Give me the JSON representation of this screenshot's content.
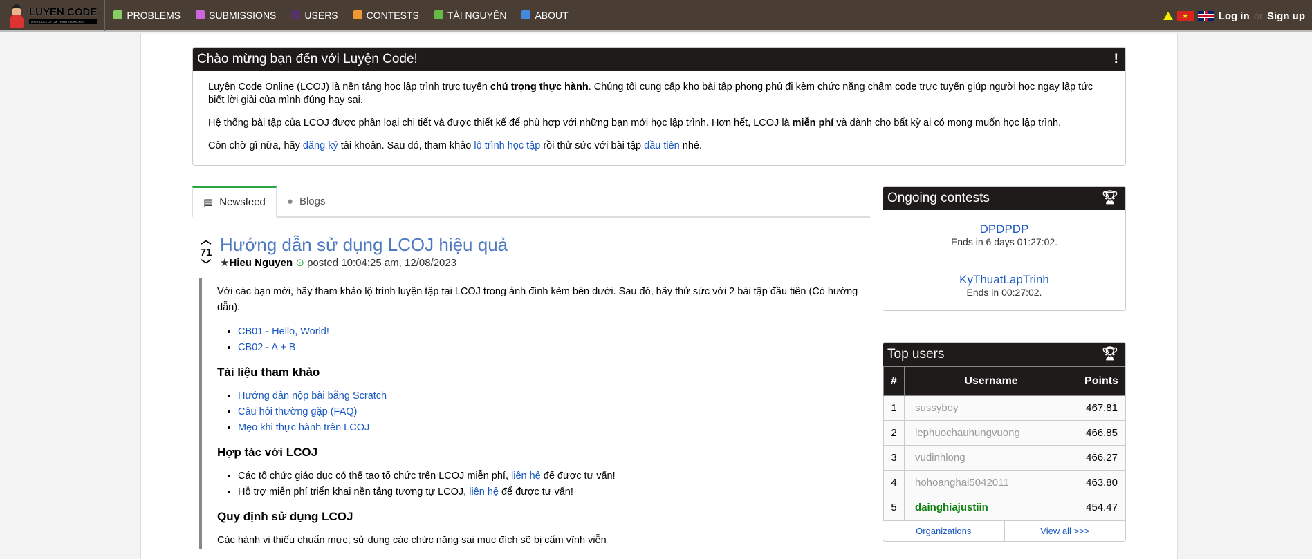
{
  "nav": {
    "logo_title": "LUYEN CODE",
    "logo_subtitle": "A PRODUCT OF LAP TRINH KHONG KHO",
    "items": [
      {
        "label": "PROBLEMS",
        "icon": "puzzle-icon",
        "color": "#8c6"
      },
      {
        "label": "SUBMISSIONS",
        "icon": "inbox-icon",
        "color": "#c6d"
      },
      {
        "label": "USERS",
        "icon": "users-icon",
        "color": "#536"
      },
      {
        "label": "CONTESTS",
        "icon": "trophy-icon",
        "color": "#e93"
      },
      {
        "label": "TÀI NGUYÊN",
        "icon": "books-icon",
        "color": "#6b4"
      },
      {
        "label": "ABOUT",
        "icon": "info-icon",
        "color": "#48d"
      }
    ],
    "login": "Log in",
    "or": "or",
    "signup": "Sign up"
  },
  "welcome": {
    "title": "Chào mừng bạn đến với Luyện Code!",
    "icon": "!",
    "p1a": "Luyện Code Online (LCOJ) là nền tảng học lập trình trực tuyến ",
    "p1b": "chú trọng thực hành",
    "p1c": ". Chúng tôi cung cấp kho bài tập phong phú đi kèm chức năng chấm code trực tuyến giúp người học ngay lập tức biết lời giải của mình đúng hay sai.",
    "p2a": "Hệ thống bài tập của LCOJ được phân loại chi tiết và được thiết kế để phù hợp với những bạn mới học lập trình. Hơn hết, LCOJ là ",
    "p2b": "miễn phí",
    "p2c": " và dành cho bất kỳ ai có mong muốn học lập trình.",
    "p3a": "Còn chờ gì nữa, hãy ",
    "p3b": "đăng ký",
    "p3c": " tài khoản. Sau đó, tham khảo ",
    "p3d": "lộ trình học tập",
    "p3e": " rồi thử sức với bài tập ",
    "p3f": "đầu tiên",
    "p3g": " nhé."
  },
  "tabs": [
    {
      "label": "Newsfeed",
      "active": true
    },
    {
      "label": "Blogs",
      "active": false
    }
  ],
  "post": {
    "votes": "71",
    "title": "Hướng dẫn sử dụng LCOJ hiệu quả",
    "author": "Hieu Nguyen",
    "posted": "posted 10:04:25 am, 12/08/2023",
    "intro": "Với các bạn mới, hãy tham khảo lộ trình luyện tập tại LCOJ trong ảnh đính kèm bên dưới. Sau đó, hãy thử sức với 2 bài tập đầu tiên (Có hướng dẫn).",
    "links1": [
      "CB01 - Hello, World!",
      "CB02 - A + B"
    ],
    "h1": "Tài liệu tham khảo",
    "links2": [
      "Hướng dẫn nộp bài bằng Scratch",
      "Câu hỏi thường gặp (FAQ)",
      "Mẹo khi thực hành trên LCOJ"
    ],
    "h2": "Hợp tác với LCOJ",
    "b1a": "Các tổ chức giáo dục có thể tạo tổ chức trên LCOJ miễn phí, ",
    "b1b": "liên hệ",
    "b1c": " để được tư vấn!",
    "b2a": "Hỗ trợ miễn phí triển khai nền tảng tương tự LCOJ, ",
    "b2b": "liên hệ",
    "b2c": " để được tư vấn!",
    "h3": "Quy định sử dụng LCOJ",
    "rules": "Các hành vi thiếu chuẩn mực, sử dụng các chức năng sai mục đích sẽ bị cấm vĩnh viễn"
  },
  "contests": {
    "title": "Ongoing contests",
    "items": [
      {
        "name": "DPDPDP",
        "ends": "Ends in 6 days 01:27:02."
      },
      {
        "name": "KyThuatLapTrinh",
        "ends": "Ends in 00:27:02."
      }
    ]
  },
  "topusers": {
    "title": "Top users",
    "headers": [
      "#",
      "Username",
      "Points"
    ],
    "rows": [
      {
        "rank": "1",
        "user": "sussyboy",
        "points": "467.81"
      },
      {
        "rank": "2",
        "user": "lephuochauhungvuong",
        "points": "466.85"
      },
      {
        "rank": "3",
        "user": "vudinhlong",
        "points": "466.27"
      },
      {
        "rank": "4",
        "user": "hohoanghai5042011",
        "points": "463.80"
      },
      {
        "rank": "5",
        "user": "dainghiajustiin",
        "points": "454.47"
      }
    ],
    "organizations": "Organizations",
    "view_all": "View all >>>"
  }
}
